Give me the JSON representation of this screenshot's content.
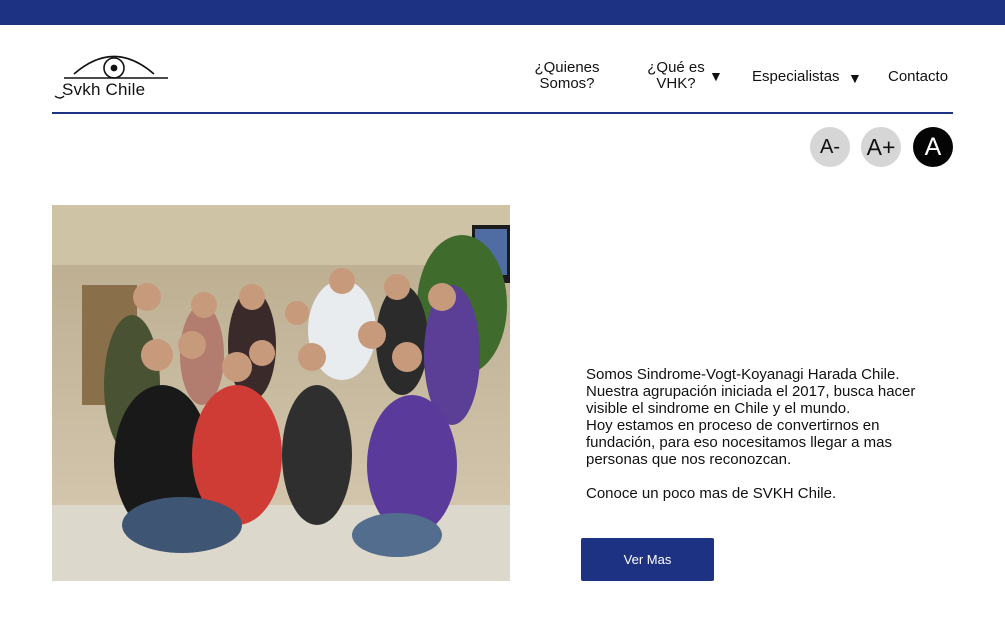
{
  "header": {
    "logo_text": "Svkh Chile",
    "nav": {
      "quienes_line1": "¿Quienes",
      "quienes_line2": "Somos?",
      "vhk_line1": "¿Qué es",
      "vhk_line2": "VHK?",
      "especialistas": "Especialistas",
      "contacto": "Contacto",
      "dropdown_icon": "▼"
    }
  },
  "font_controls": {
    "decrease": "A-",
    "increase": "A+",
    "reset": "A"
  },
  "main": {
    "paragraph_lines": [
      "Somos Sindrome-Vogt-Koyanagi Harada Chile.",
      "Nuestra agrupación iniciada el 2017, busca hacer",
      "visible el sindrome en Chile y el mundo.",
      "Hoy estamos en proceso de convertirnos en",
      "fundación, para eso nocesitamos llegar a mas",
      "personas que nos reconozcan."
    ],
    "cta_text": "Conoce un poco mas de SVKH Chile.",
    "button_label": "Ver Mas"
  },
  "colors": {
    "brand_blue": "#1d3283",
    "font_button_light": "#d6d6d6",
    "font_button_dark": "#050505"
  }
}
